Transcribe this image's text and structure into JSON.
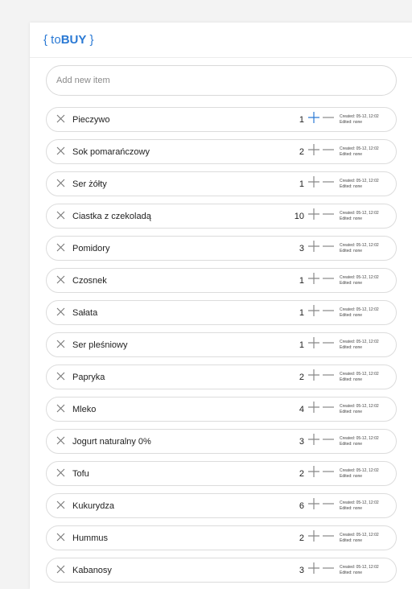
{
  "app": {
    "brand_open": "{ to",
    "brand_bold": "BUY",
    "brand_close": " }",
    "accent_color": "#2a79d4"
  },
  "add_item": {
    "placeholder": "Add new item"
  },
  "items": [
    {
      "name": "Pieczywo",
      "qty": "1",
      "created": "Created: 05-12, 12:02",
      "edited": "Edited: none",
      "plus_active": true
    },
    {
      "name": "Sok pomarańczowy",
      "qty": "2",
      "created": "Created: 05-12, 12:02",
      "edited": "Edited: none"
    },
    {
      "name": "Ser żółty",
      "qty": "1",
      "created": "Created: 05-12, 12:02",
      "edited": "Edited: none"
    },
    {
      "name": "Ciastka z czekoladą",
      "qty": "10",
      "created": "Created: 05-12, 12:02",
      "edited": "Edited: none"
    },
    {
      "name": "Pomidory",
      "qty": "3",
      "created": "Created: 05-12, 12:02",
      "edited": "Edited: none"
    },
    {
      "name": "Czosnek",
      "qty": "1",
      "created": "Created: 05-12, 12:02",
      "edited": "Edited: none"
    },
    {
      "name": "Sałata",
      "qty": "1",
      "created": "Created: 05-12, 12:02",
      "edited": "Edited: none"
    },
    {
      "name": "Ser pleśniowy",
      "qty": "1",
      "created": "Created: 05-12, 12:02",
      "edited": "Edited: none"
    },
    {
      "name": "Papryka",
      "qty": "2",
      "created": "Created: 05-12, 12:02",
      "edited": "Edited: none"
    },
    {
      "name": "Mleko",
      "qty": "4",
      "created": "Created: 05-12, 12:02",
      "edited": "Edited: none"
    },
    {
      "name": "Jogurt naturalny 0%",
      "qty": "3",
      "created": "Created: 05-12, 12:02",
      "edited": "Edited: none"
    },
    {
      "name": "Tofu",
      "qty": "2",
      "created": "Created: 05-12, 12:02",
      "edited": "Edited: none"
    },
    {
      "name": "Kukurydza",
      "qty": "6",
      "created": "Created: 05-12, 12:02",
      "edited": "Edited: none"
    },
    {
      "name": "Hummus",
      "qty": "2",
      "created": "Created: 05-12, 12:02",
      "edited": "Edited: none"
    },
    {
      "name": "Kabanosy",
      "qty": "3",
      "created": "Created: 05-12, 12:02",
      "edited": "Edited: none"
    }
  ]
}
